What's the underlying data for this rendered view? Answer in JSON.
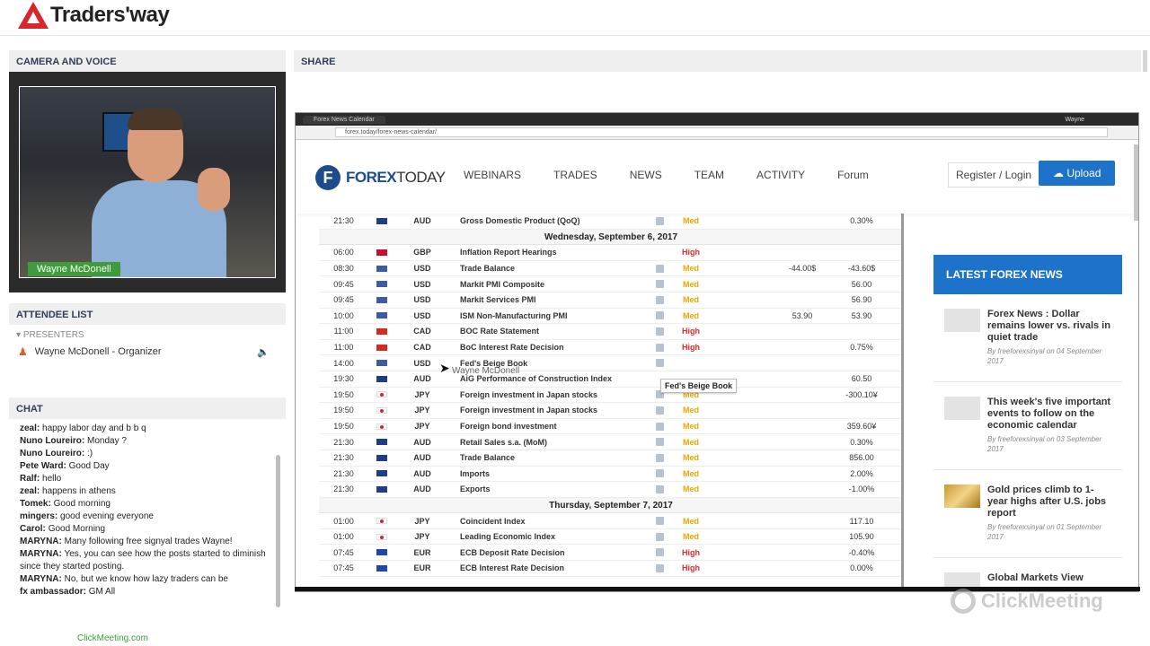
{
  "brand": {
    "name": "Traders'way"
  },
  "camera": {
    "header": "CAMERA AND VOICE",
    "presenter_label": "Wayne McDonell"
  },
  "attendees": {
    "header": "ATTENDEE LIST",
    "section": "PRESENTERS",
    "list": [
      {
        "name": "Wayne McDonell - Organizer"
      }
    ]
  },
  "chat": {
    "header": "CHAT",
    "messages": [
      {
        "user": "zeal:",
        "text": "happy labor day and b b q"
      },
      {
        "user": "Nuno Loureiro:",
        "text": "Monday ?"
      },
      {
        "user": "Nuno Loureiro:",
        "text": ":)"
      },
      {
        "user": "Pete Ward:",
        "text": "Good Day"
      },
      {
        "user": "Ralf:",
        "text": "hello"
      },
      {
        "user": "zeal:",
        "text": "happens in athens"
      },
      {
        "user": "Tomek:",
        "text": "Good morning"
      },
      {
        "user": "mingers:",
        "text": "good evening everyone"
      },
      {
        "user": "Carol:",
        "text": "Good Morning"
      },
      {
        "user": "MARYNA:",
        "text": "Many following free signyal trades Wayne!"
      },
      {
        "user": "MARYNA:",
        "text": "Yes, you can see how the posts started to diminish since they started posting."
      },
      {
        "user": "MARYNA:",
        "text": "No, but we know how lazy traders can be"
      },
      {
        "user": "fx ambassador:",
        "text": "GM All"
      }
    ]
  },
  "footer": {
    "link": "ClickMeeting.com"
  },
  "share": {
    "header": "SHARE"
  },
  "browser": {
    "tab": "Forex News Calendar",
    "user": "Wayne",
    "url": "forex.today/forex-news-calendar/"
  },
  "site": {
    "logo_a": "FOREX",
    "logo_b": "TODAY",
    "nav": [
      "WEBINARS",
      "TRADES",
      "NEWS",
      "TEAM",
      "ACTIVITY",
      "Forum"
    ],
    "register": "Register / Login",
    "upload": "Upload"
  },
  "calendar": {
    "rows": [
      {
        "type": "event",
        "time": "21:30",
        "flag": "au",
        "cur": "AUD",
        "event": "Gross Domestic Product (QoQ)",
        "imp": "Med",
        "act": "",
        "fc": "",
        "pr": "0.30%"
      },
      {
        "type": "date",
        "label": "Wednesday, September 6, 2017"
      },
      {
        "type": "event",
        "time": "06:00",
        "flag": "gb",
        "cur": "GBP",
        "event": "Inflation Report Hearings",
        "imp": "High",
        "act": "",
        "fc": "",
        "pr": "",
        "noinfo": true
      },
      {
        "type": "event",
        "time": "08:30",
        "flag": "us",
        "cur": "USD",
        "event": "Trade Balance",
        "imp": "Med",
        "act": "",
        "fc": "-44.00$",
        "pr": "-43.60$"
      },
      {
        "type": "event",
        "time": "09:45",
        "flag": "us",
        "cur": "USD",
        "event": "Markit PMI Composite",
        "imp": "Med",
        "act": "",
        "fc": "",
        "pr": "56.00"
      },
      {
        "type": "event",
        "time": "09:45",
        "flag": "us",
        "cur": "USD",
        "event": "Markit Services PMI",
        "imp": "Med",
        "act": "",
        "fc": "",
        "pr": "56.90"
      },
      {
        "type": "event",
        "time": "10:00",
        "flag": "us",
        "cur": "USD",
        "event": "ISM Non-Manufacturing PMI",
        "imp": "Med",
        "act": "",
        "fc": "53.90",
        "pr": "53.90"
      },
      {
        "type": "event",
        "time": "11:00",
        "flag": "ca",
        "cur": "CAD",
        "event": "BOC Rate Statement",
        "imp": "High",
        "act": "",
        "fc": "",
        "pr": ""
      },
      {
        "type": "event",
        "time": "11:00",
        "flag": "ca",
        "cur": "CAD",
        "event": "BoC Interest Rate Decision",
        "imp": "High",
        "act": "",
        "fc": "",
        "pr": "0.75%"
      },
      {
        "type": "event",
        "time": "14:00",
        "flag": "us",
        "cur": "USD",
        "event": "Fed's Beige Book",
        "imp": "",
        "act": "",
        "fc": "",
        "pr": ""
      },
      {
        "type": "event",
        "time": "19:30",
        "flag": "au",
        "cur": "AUD",
        "event": "AiG Performance of Construction Index",
        "imp": "",
        "act": "",
        "fc": "",
        "pr": "60.50",
        "noinfo": true
      },
      {
        "type": "event",
        "time": "19:50",
        "flag": "jp",
        "cur": "JPY",
        "event": "Foreign investment in Japan stocks",
        "imp": "Med",
        "act": "",
        "fc": "",
        "pr": "-300.10¥"
      },
      {
        "type": "event",
        "time": "19:50",
        "flag": "jp",
        "cur": "JPY",
        "event": "Foreign investment in Japan stocks",
        "imp": "Med",
        "act": "",
        "fc": "",
        "pr": ""
      },
      {
        "type": "event",
        "time": "19:50",
        "flag": "jp",
        "cur": "JPY",
        "event": "Foreign bond investment",
        "imp": "Med",
        "act": "",
        "fc": "",
        "pr": "359.60¥"
      },
      {
        "type": "event",
        "time": "21:30",
        "flag": "au",
        "cur": "AUD",
        "event": "Retail Sales s.a. (MoM)",
        "imp": "Med",
        "act": "",
        "fc": "",
        "pr": "0.30%"
      },
      {
        "type": "event",
        "time": "21:30",
        "flag": "au",
        "cur": "AUD",
        "event": "Trade Balance",
        "imp": "Med",
        "act": "",
        "fc": "",
        "pr": "856.00"
      },
      {
        "type": "event",
        "time": "21:30",
        "flag": "au",
        "cur": "AUD",
        "event": "Imports",
        "imp": "Med",
        "act": "",
        "fc": "",
        "pr": "2.00%"
      },
      {
        "type": "event",
        "time": "21:30",
        "flag": "au",
        "cur": "AUD",
        "event": "Exports",
        "imp": "Med",
        "act": "",
        "fc": "",
        "pr": "-1.00%"
      },
      {
        "type": "date",
        "label": "Thursday, September 7, 2017"
      },
      {
        "type": "event",
        "time": "01:00",
        "flag": "jp",
        "cur": "JPY",
        "event": "Coincident Index",
        "imp": "Med",
        "act": "",
        "fc": "",
        "pr": "117.10"
      },
      {
        "type": "event",
        "time": "01:00",
        "flag": "jp",
        "cur": "JPY",
        "event": "Leading Economic Index",
        "imp": "Med",
        "act": "",
        "fc": "",
        "pr": "105.90"
      },
      {
        "type": "event",
        "time": "07:45",
        "flag": "eu",
        "cur": "EUR",
        "event": "ECB Deposit Rate Decision",
        "imp": "High",
        "act": "",
        "fc": "",
        "pr": "-0.40%"
      },
      {
        "type": "event",
        "time": "07:45",
        "flag": "eu",
        "cur": "EUR",
        "event": "ECB Interest Rate Decision",
        "imp": "High",
        "act": "",
        "fc": "",
        "pr": "0.00%"
      }
    ]
  },
  "tooltip": "Fed's Beige Book",
  "cursor_label": "Wayne McDonell",
  "sidebar": {
    "header": "LATEST FOREX NEWS",
    "news": [
      {
        "title": "Forex News : Dollar remains lower vs. rivals in quiet trade",
        "meta": "By freeforexsinyal on 04 September 2017",
        "thumb": "plain"
      },
      {
        "title": "This week's five important events to follow on the economic calendar",
        "meta": "By freeforexsinyal on 03 September 2017",
        "thumb": "plain"
      },
      {
        "title": "Gold prices climb to 1-year highs after U.S. jobs report",
        "meta": "By freeforexsinyal on 01 September 2017",
        "thumb": "gold"
      },
      {
        "title": "Global Markets View",
        "meta": "",
        "thumb": "plain"
      }
    ]
  },
  "watermark": "ClickMeeting",
  "flag_colors": {
    "au": "#1f3c88",
    "gb": "#c8102e",
    "us": "#3c5aa6",
    "ca": "#d52b1e",
    "jp": "#e02030",
    "eu": "#1f47a8"
  },
  "colors": {
    "accent": "#1c73c9",
    "high": "#e22a2a",
    "med": "#f0a400",
    "green": "#3f9b3c"
  }
}
